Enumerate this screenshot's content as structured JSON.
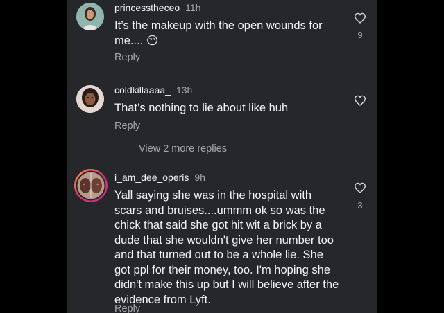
{
  "comments": [
    {
      "username": "princesstheceo",
      "time": "11h",
      "text": "It’s the makeup with the open wounds for me.... 😒",
      "reply": "Reply",
      "likes": "9"
    },
    {
      "username": "coldkillaaaa_",
      "time": "13h",
      "text": "That’s nothing to lie about like huh",
      "reply": "Reply",
      "likes": ""
    },
    {
      "username": "i_am_dee_operis",
      "time": "9h",
      "text": "Yall saying she was in the hospital with scars and bruises....ummm ok so was the chick that said she got hit wit a brick by a dude that she wouldn't give her number too and that turned out to be a whole lie. She got ppl for their money, too. I'm hoping she didn't make this up but I will believe after the evidence from Lyft.",
      "reply": "Reply",
      "likes": "3"
    }
  ],
  "view_more": "View 2 more replies",
  "icons": {
    "like": "heart-outline-icon"
  },
  "colors": {
    "background": "#26272b",
    "text": "#f5f5f5",
    "muted": "#a8a8a8",
    "story_ring": "#e1306c"
  }
}
